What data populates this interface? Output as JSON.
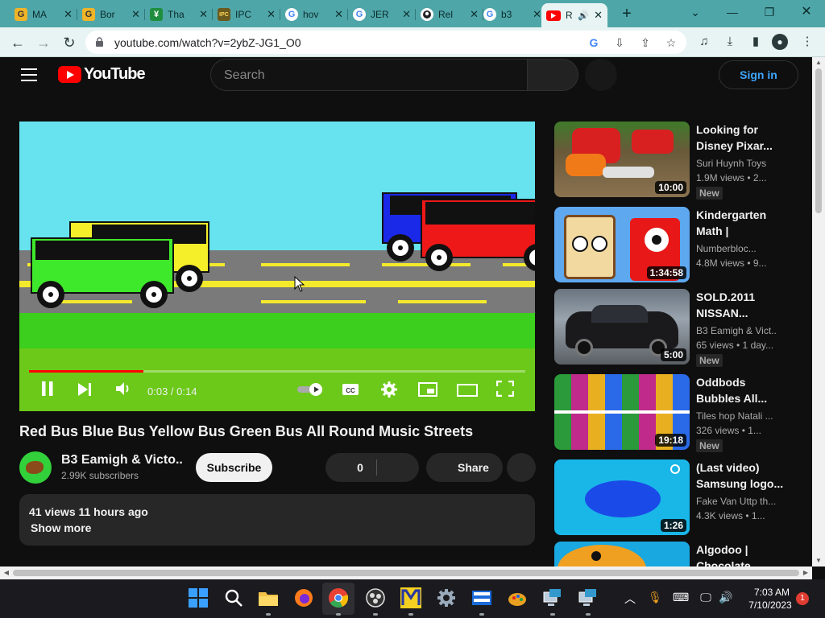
{
  "browser": {
    "tabs": [
      {
        "title": "MA",
        "favicon": "G",
        "favicon_color": "#f0b429"
      },
      {
        "title": "Bor",
        "favicon": "G",
        "favicon_color": "#f0b429"
      },
      {
        "title": "Tha",
        "favicon": "¥",
        "favicon_color": "#1e8e3e"
      },
      {
        "title": "IPC",
        "favicon": "IPC",
        "favicon_color": "#6b5a1e"
      },
      {
        "title": "hov",
        "favicon": "G",
        "favicon_color": "#ffffff"
      },
      {
        "title": "JER",
        "favicon": "G",
        "favicon_color": "#ffffff"
      },
      {
        "title": "Rel",
        "favicon": "gh",
        "favicon_color": "#ffffff"
      },
      {
        "title": "b3",
        "favicon": "G",
        "favicon_color": "#ffffff"
      },
      {
        "title": "R",
        "favicon": "yt",
        "favicon_color": "#ff0000",
        "active": true
      }
    ],
    "close_glyph": "✕",
    "new_tab_glyph": "+",
    "url": "youtube.com/watch?v=2ybZ-JG1_O0"
  },
  "youtube": {
    "brand": "YouTube",
    "search_placeholder": "Search",
    "signin_label": "Sign in",
    "video": {
      "title": "Red Bus Blue Bus Yellow Bus Green Bus All Round Music Streets",
      "current_time": "0:03",
      "duration": "0:14",
      "time_display": "0:03 / 0:14",
      "progress": 0.23
    },
    "channel": {
      "name": "B3 Eamigh & Victo...",
      "subscribers": "2.99K subscribers",
      "subscribe_label": "Subscribe"
    },
    "likes": "0",
    "share_label": "Share",
    "description": {
      "meta": "41 views  11 hours ago",
      "show_more": "Show more"
    },
    "recommendations": [
      {
        "title": "Looking for Disney Pixar...",
        "channel": "Suri Huynh Toys",
        "views": "1.9M views  •  2...",
        "duration": "10:00",
        "badge": "New"
      },
      {
        "title": "Kindergarten Math |",
        "channel": "Numberbloc...",
        "views": "4.8M views  •  9...",
        "duration": "1:34:58",
        "badge": ""
      },
      {
        "title": "SOLD.2011 NISSAN...",
        "channel": "B3 Eamigh & Vict...",
        "views": "65 views  •  1 day...",
        "duration": "5:00",
        "badge": "New"
      },
      {
        "title": "Oddbods Bubbles All...",
        "channel": "Tiles hop Natali ...",
        "views": "326 views  •  1...",
        "duration": "19:18",
        "badge": "New"
      },
      {
        "title": "(Last video) Samsung logo...",
        "channel": "Fake Van Uttp th...",
        "views": "4.3K views  •  1...",
        "duration": "1:26",
        "badge": ""
      },
      {
        "title": "Algodoo | Chocolate",
        "channel": "",
        "views": "",
        "duration": "",
        "badge": ""
      }
    ]
  },
  "taskbar": {
    "time": "7:03 AM",
    "date": "7/10/2023",
    "notifications": "1"
  },
  "colors": {
    "tabstrip": "#4fa6a8",
    "toolbar": "#e8f4f3",
    "yt_bg": "#0f0f0f",
    "progress": "#ff0000",
    "signin": "#3ea6ff"
  }
}
